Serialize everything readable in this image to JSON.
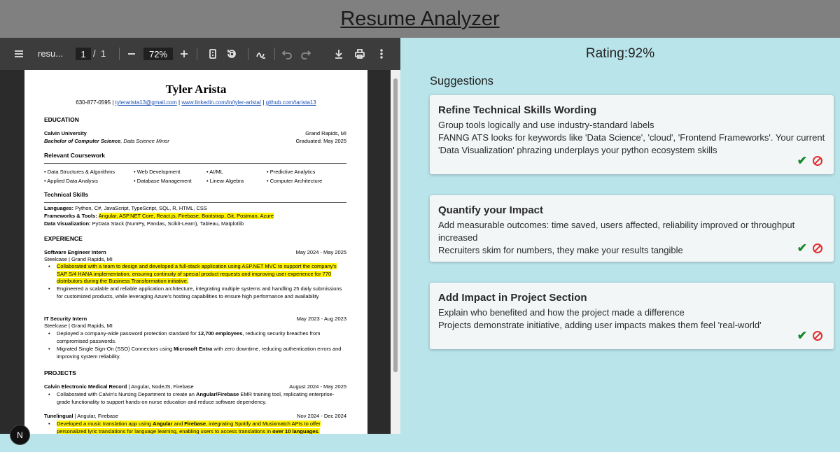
{
  "app": {
    "title": "Resume Analyzer"
  },
  "viewer": {
    "filename": "resu...",
    "page_current": "1",
    "page_sep": "/",
    "page_total": "1",
    "zoom": "72%"
  },
  "resume": {
    "name": "Tyler Arista",
    "contact": {
      "phone": "630-877-0595 | ",
      "email": "tylerarista13@gmail.com",
      "sep": " | ",
      "linkedin": "www.linkedin.com/in/tyler-arista/",
      "sep2": " | ",
      "github": "github.com/tarista13"
    },
    "education": {
      "heading": "EDUCATION",
      "school": "Calvin University",
      "location": "Grand Rapids, MI",
      "degree": "Bachelor of Computer Science",
      "minor": ", Data Science Minor",
      "graduated": "Graduated: May 2025"
    },
    "coursework": {
      "heading": "Relevant Coursework",
      "items": [
        "Data Structures & Algorithms",
        "Web Development",
        "AI/ML",
        "Predictive Analytics",
        "Applied Data Analysis",
        "Database Management",
        "Linear Algebra",
        "Computer Architecture"
      ]
    },
    "skills": {
      "heading": "Technical Skills",
      "languages_label": "Languages: ",
      "languages": "Python, C#, JavaScript, TypeScript, SQL, R, HTML, CSS",
      "frameworks_label": "Frameworks & Tools: ",
      "frameworks": "Angular, ASP.NET Core, React.js, Firebase, Bootstrap, Git, Postman, Azure",
      "viz_label": "Data Visualization: ",
      "viz": "PyData Stack (NumPy, Pandas, Scikit-Learn), Tableau, Matplotlib"
    },
    "experience": {
      "heading": "EXPERIENCE",
      "job1_title": "Software Engineer Intern",
      "job1_dates": "May 2024 - May 2025",
      "job1_company": "Steelcase | Grand Rapids, MI",
      "job1_b1": "Collaborated with a team to design and developed a full-stack application using ASP.NET MVC to support the company's SAP S/4 HANA implementation, ensuring continuity of special product requests and improving user experience for 770 distributors during the Business Transformation initiative.",
      "job1_b2": "Engineered a scalable and reliable application architecture, integrating multiple systems and handling 25 daily submissions for customized products, while leveraging Azure's hosting capabilities to ensure high performance and availability",
      "job2_title": "IT Security Intern",
      "job2_dates": "May 2023 - Aug 2023",
      "job2_company": "Steelcase | Grand Rapids, MI",
      "job2_b1_a": "Deployed a company-wide password protection standard for ",
      "job2_b1_b": "12,700 employees",
      "job2_b1_c": ", reducing security breaches from compromised passwords.",
      "job2_b2_a": "Migrated Single Sign-On (SSO) Connectors using ",
      "job2_b2_b": "Microsoft Entra",
      "job2_b2_c": " with zero downtime, reducing authentication errors and improving system reliability."
    },
    "projects": {
      "heading": "PROJECTS",
      "p1_title": "Calvin Electronic Medical Record",
      "p1_tech": " | Angular, NodeJS, Firebase",
      "p1_dates": "August 2024 - May 2025",
      "p1_b1_a": "Collaborated with Calvin's Nursing Department to create an ",
      "p1_b1_b": "Angular/Firebase",
      "p1_b1_c": " EMR training tool, replicating enterprise-grade functionality to support hands-on nurse education and reduce software dependency.",
      "p2_title": "Tunelingual",
      "p2_tech": " | Angular, Firebase",
      "p2_dates": "Nov 2024 - Dec 2024",
      "p2_b1_a": "Developed a music translation app using ",
      "p2_b1_b": "Angular",
      "p2_b1_c": " and ",
      "p2_b1_d": "Firebase",
      "p2_b1_e": ", integrating Spotify and Musixmatch APIs to offer personalized lyric translations for language learning, enabling users to access translations in ",
      "p2_b1_f": "over 10 languages",
      "p2_b1_g": "."
    }
  },
  "analysis": {
    "rating": "Rating:92%",
    "suggestions_title": "Suggestions",
    "cards": [
      {
        "title": "Refine Technical Skills Wording",
        "line1": "Group tools logically and use industry-standard labels",
        "line2": "FANNG ATS looks for keywords like 'Data Science', 'cloud', 'Frontend Frameworks'. Your current 'Data Visualization' phrazing underplays your python ecosystem skills"
      },
      {
        "title": "Quantify your Impact",
        "line1": "Add measurable outcomes: time saved, users affected, reliability improved or throughput increased",
        "line2": "Recruiters skim for numbers, they make your results tangible"
      },
      {
        "title": "Add Impact in Project Section",
        "line1": "Explain who benefited and how the project made a difference",
        "line2": "Projects demonstrate initiative, adding user impacts makes them feel 'real-world'"
      }
    ]
  },
  "fab": {
    "label": "N"
  }
}
